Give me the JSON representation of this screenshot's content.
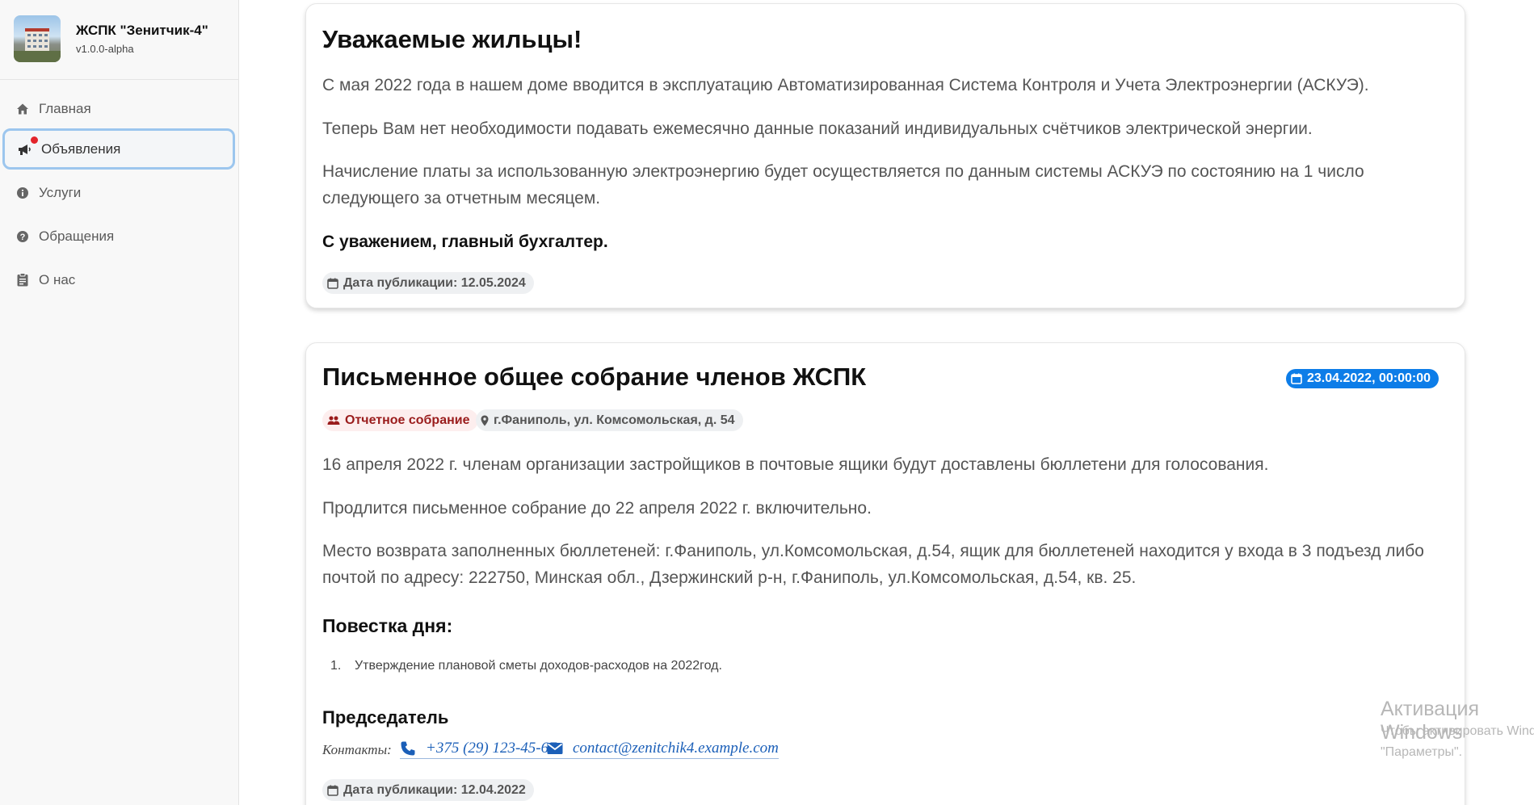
{
  "app": {
    "name": "ЖСПК \"Зенитчик-4\"",
    "version": "v1.0.0-alpha"
  },
  "sidebar": {
    "items": [
      {
        "label": "Главная",
        "icon": "home-icon"
      },
      {
        "label": "Объявления",
        "icon": "megaphone-icon",
        "active": true,
        "has_notification": true
      },
      {
        "label": "Услуги",
        "icon": "info-icon"
      },
      {
        "label": "Обращения",
        "icon": "help-icon"
      },
      {
        "label": "О нас",
        "icon": "clipboard-icon"
      }
    ]
  },
  "announcement": {
    "title": "Уважаемые жильцы!",
    "paragraphs": [
      "С мая 2022 года в нашем доме вводится в эксплуатацию Автоматизированная Система Контроля и Учета Электроэнергии (АСКУЭ).",
      "Теперь Вам нет необходимости подавать ежемесячно данные показаний индивидуальных счётчиков электрической энергии.",
      "Начисление платы за использованную электроэнергию будет осуществляется по данным системы АСКУЭ по состоянию на 1 число следующего за отчетным месяцем."
    ],
    "signature": "С уважением, главный бухгалтер.",
    "published": "Дата публикации: 12.05.2024"
  },
  "meeting": {
    "title": "Письменное общее собрание членов ЖСПК",
    "datetime": "23.04.2022, 00:00:00",
    "type_label": "Отчетное собрание",
    "location": "г.Фаниполь, ул. Комсомольская, д. 54",
    "paragraphs": [
      "16 апреля 2022 г. членам организации застройщиков в почтовые ящики будут доставлены бюллетени для голосования.",
      "Продлится письменное собрание до 22 апреля 2022 г. включительно.",
      "Место возврата заполненных бюллетеней: г.Фаниполь, ул.Комсомольская, д.54, ящик для бюллетеней находится у входа в 3 подъезд либо почтой по адресу: 222750, Минская обл., Дзержинский р-н, г.Фаниполь, ул.Комсомольская, д.54, кв. 25."
    ],
    "agenda_heading": "Повестка дня:",
    "agenda": [
      {
        "num": "1.",
        "text": "Утверждение плановой сметы доходов-расходов на 2022год."
      }
    ],
    "chairman_heading": "Председатель",
    "contacts_label": "Контакты:",
    "phone": "+375 (29) 123-45-67",
    "email": "contact@zenitchik4.example.com",
    "published": "Дата публикации: 12.04.2022"
  },
  "watermark": {
    "title": "Активация Windows",
    "text": "Чтобы активировать Windows, перейдите в раздел \"Параметры\"."
  },
  "colors": {
    "accent": "#0d7de8",
    "active_border": "#9cc6ee",
    "notification": "#e3242b",
    "meeting_type": "#9a1c1c"
  }
}
